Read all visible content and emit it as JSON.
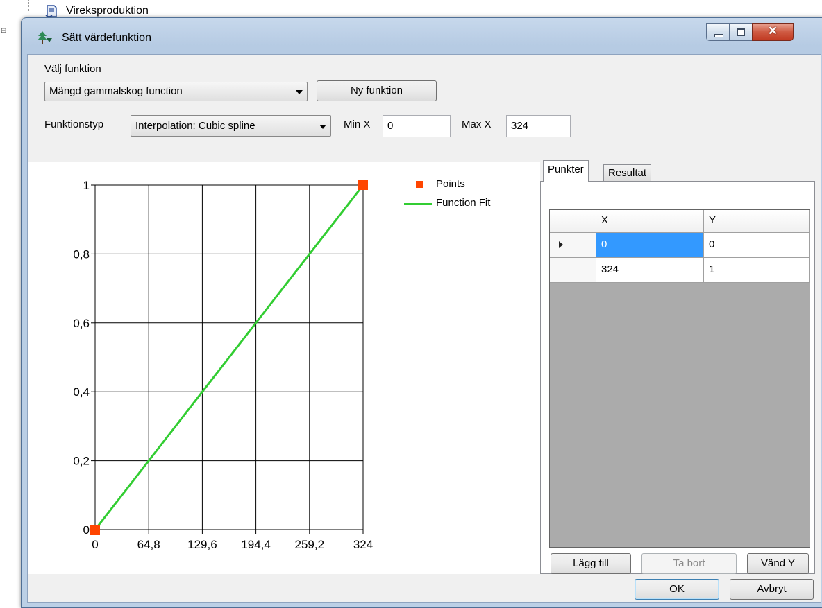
{
  "background": {
    "tree_item_label": "Vireksproduktion",
    "tree_item_icon": "document-tree-icon"
  },
  "window": {
    "title": "Sätt värdefunktion",
    "title_icon": "tree-value-icon",
    "close_glyph": "✕"
  },
  "controls": {
    "choose_function_label": "Välj funktion",
    "function_selected": "Mängd gammalskog function",
    "new_function_button": "Ny funktion",
    "function_type_label": "Funktionstyp",
    "function_type_selected": "Interpolation: Cubic spline",
    "min_x_label": "Min X",
    "min_x_value": "0",
    "max_x_label": "Max X",
    "max_x_value": "324"
  },
  "chart_data": {
    "type": "line",
    "title": "",
    "xlabel": "",
    "ylabel": "",
    "xlim": [
      0,
      324
    ],
    "ylim": [
      0,
      1
    ],
    "x_ticks": [
      "0",
      "64,8",
      "129,6",
      "194,4",
      "259,2",
      "324"
    ],
    "x_tick_values": [
      0,
      64.8,
      129.6,
      194.4,
      259.2,
      324
    ],
    "y_ticks": [
      "0",
      "0,2",
      "0,4",
      "0,6",
      "0,8",
      "1"
    ],
    "y_tick_values": [
      0,
      0.2,
      0.4,
      0.6,
      0.8,
      1
    ],
    "grid": true,
    "legend_position": "top-right",
    "series": [
      {
        "name": "Points",
        "kind": "scatter",
        "color": "#ff4500",
        "x": [
          0,
          324
        ],
        "y": [
          0,
          1
        ]
      },
      {
        "name": "Function Fit",
        "kind": "line",
        "color": "#32cd32",
        "x": [
          0,
          324
        ],
        "y": [
          0,
          1
        ]
      }
    ]
  },
  "tabs": [
    {
      "label": "Punkter",
      "active": true
    },
    {
      "label": "Resultat",
      "active": false
    }
  ],
  "points_table": {
    "columns": [
      "X",
      "Y"
    ],
    "rows": [
      [
        "0",
        "0"
      ],
      [
        "324",
        "1"
      ]
    ]
  },
  "table_buttons": {
    "add": "Lägg till",
    "remove": "Ta bort",
    "flip_y": "Vänd Y"
  },
  "dialog_buttons": {
    "ok": "OK",
    "cancel": "Avbryt"
  }
}
